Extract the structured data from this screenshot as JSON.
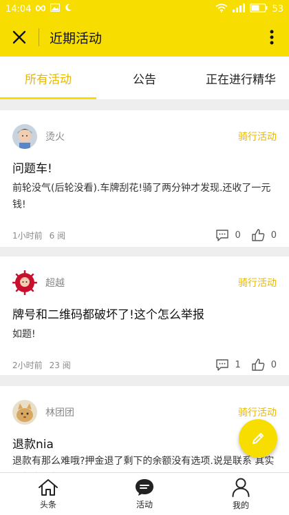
{
  "status_bar": {
    "time": "14:04",
    "battery": "53"
  },
  "app_bar": {
    "title": "近期活动"
  },
  "tabs": [
    {
      "label": "所有活动"
    },
    {
      "label": "公告"
    },
    {
      "label": "正在进行精华"
    }
  ],
  "posts": [
    {
      "author": "烫火",
      "category": "骑行活动",
      "title": "问题车!",
      "body": "前轮没气(后轮没看).车牌刮花!骑了两分钟才发现.还收了一元钱!",
      "time": "1小时前",
      "views": "6 阅",
      "comments": "0",
      "likes": "0"
    },
    {
      "author": "超越",
      "category": "骑行活动",
      "title": "牌号和二维码都破坏了!这个怎么举报",
      "body": "如题!",
      "time": "2小时前",
      "views": "23 阅",
      "comments": "1",
      "likes": "0"
    },
    {
      "author": "林团团",
      "category": "骑行活动",
      "title": "退款nia",
      "body": "退款有那么难哦?押金退了剩下的余额没有选项.说是联系 其实要打电话超恶心"
    }
  ],
  "bottom_nav": [
    {
      "label": "头条",
      "icon": "home-icon"
    },
    {
      "label": "活动",
      "icon": "chat-bubble-icon"
    },
    {
      "label": "我的",
      "icon": "person-icon"
    }
  ],
  "colors": {
    "accent": "#f7de00",
    "accent_text": "#e8b800"
  }
}
